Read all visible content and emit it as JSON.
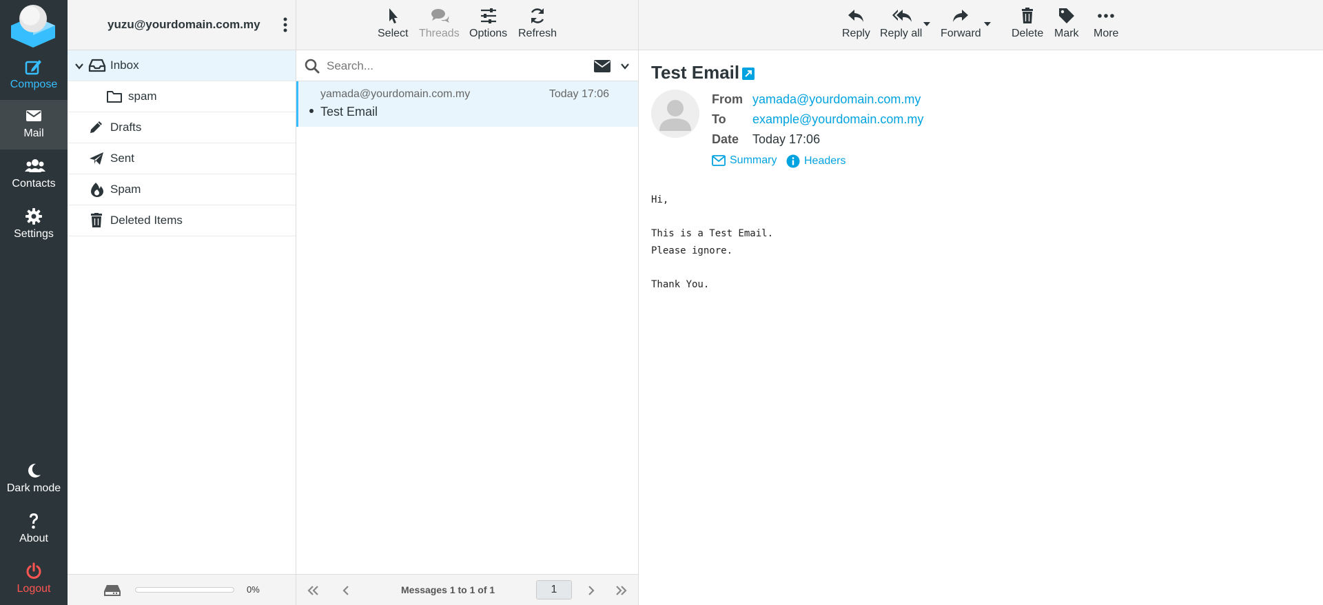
{
  "nav": {
    "compose": "Compose",
    "mail": "Mail",
    "contacts": "Contacts",
    "settings": "Settings",
    "dark_mode": "Dark mode",
    "about": "About",
    "logout": "Logout"
  },
  "account": "yuzu@yourdomain.com.my",
  "folders": [
    {
      "label": "Inbox",
      "icon": "inbox-icon",
      "active": true
    },
    {
      "label": "spam",
      "icon": "folder-icon",
      "sub": true
    },
    {
      "label": "Drafts",
      "icon": "pencil-icon"
    },
    {
      "label": "Sent",
      "icon": "paper-plane-icon"
    },
    {
      "label": "Spam",
      "icon": "flame-icon"
    },
    {
      "label": "Deleted Items",
      "icon": "trash-icon"
    }
  ],
  "quota": {
    "text": "0%",
    "percent": 0
  },
  "list_toolbar": {
    "select": "Select",
    "threads": "Threads",
    "options": "Options",
    "refresh": "Refresh"
  },
  "search": {
    "placeholder": "Search..."
  },
  "messages": [
    {
      "from": "yamada@yourdomain.com.my",
      "time": "Today 17:06",
      "subject": "Test Email"
    }
  ],
  "pagination": {
    "count_text": "Messages 1 to 1 of 1",
    "page": "1"
  },
  "reader_toolbar": {
    "reply": "Reply",
    "reply_all": "Reply all",
    "forward": "Forward",
    "delete": "Delete",
    "mark": "Mark",
    "more": "More"
  },
  "email": {
    "subject": "Test Email",
    "from_label": "From",
    "from": "yamada@yourdomain.com.my",
    "to_label": "To",
    "to": "example@yourdomain.com.my",
    "date_label": "Date",
    "date": "Today 17:06",
    "summary_link": "Summary",
    "headers_link": "Headers",
    "body": "Hi,\n\nThis is a Test Email.\nPlease ignore.\n\nThank You."
  },
  "colors": {
    "accent": "#37beff",
    "link": "#00a3e0",
    "rail": "#2c363a",
    "logout": "#ff5552"
  }
}
